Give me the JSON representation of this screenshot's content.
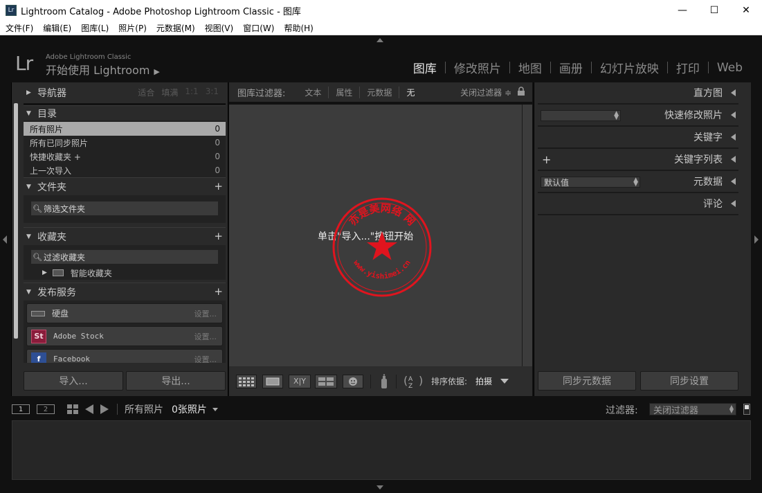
{
  "window": {
    "title": "Lightroom Catalog - Adobe Photoshop Lightroom Classic - 图库",
    "icon_text": "Lr",
    "minimize": "—",
    "maximize": "☐",
    "close": "✕"
  },
  "menubar": [
    "文件(F)",
    "编辑(E)",
    "图库(L)",
    "照片(P)",
    "元数据(M)",
    "视图(V)",
    "窗口(W)",
    "帮助(H)"
  ],
  "identity": {
    "logo": "Lr",
    "small": "Adobe Lightroom Classic",
    "main": "开始使用 Lightroom",
    "play": "▶"
  },
  "modules": [
    "图库",
    "修改照片",
    "地图",
    "画册",
    "幻灯片放映",
    "打印",
    "Web"
  ],
  "left": {
    "navigator": {
      "title": "导航器",
      "options": [
        "适合",
        "填满",
        "1:1",
        "3:1"
      ]
    },
    "catalog": {
      "title": "目录",
      "items": [
        {
          "label": "所有照片",
          "count": "0"
        },
        {
          "label": "所有已同步照片",
          "count": "0"
        },
        {
          "label": "快捷收藏夹 +",
          "count": "0"
        },
        {
          "label": "上一次导入",
          "count": "0"
        }
      ]
    },
    "folders": {
      "title": "文件夹",
      "filter_placeholder": "筛选文件夹",
      "plus": "+"
    },
    "collections": {
      "title": "收藏夹",
      "filter_placeholder": "过滤收藏夹",
      "plus": "+",
      "smart": "智能收藏夹"
    },
    "publish": {
      "title": "发布服务",
      "plus": "+",
      "services": [
        {
          "name": "硬盘",
          "setup": "设置..."
        },
        {
          "name": "Adobe Stock",
          "setup": "设置...",
          "icon": "St"
        },
        {
          "name": "Facebook",
          "setup": "设置...",
          "icon": "f"
        }
      ]
    },
    "import_label": "导入...",
    "export_label": "导出..."
  },
  "filterbar": {
    "title": "图库过滤器:",
    "items": [
      "文本",
      "属性",
      "元数据",
      "无"
    ],
    "preset": "关闭过滤器 ≑"
  },
  "grid": {
    "empty_message": "单击\"导入...\"按钮开始"
  },
  "toolbar": {
    "sort_label": "排序依据:",
    "sort_value": "拍摄"
  },
  "right": {
    "panels": [
      {
        "title": "直方图"
      },
      {
        "title": "快速修改照片",
        "dropdown": ""
      },
      {
        "title": "关键字"
      },
      {
        "title": "关键字列表",
        "plus": "+"
      },
      {
        "title": "元数据",
        "dropdown": "默认值"
      },
      {
        "title": "评论"
      }
    ],
    "sync_metadata": "同步元数据",
    "sync_settings": "同步设置"
  },
  "filmstrip": {
    "mon1": "1",
    "mon2": "2",
    "source": "所有照片",
    "photos": "0张照片",
    "filter_label": "过滤器:",
    "filter_value": "关闭过滤器"
  },
  "watermark": {
    "outer_text": "亦是美网络 网",
    "url": "www.yishimei.cn",
    "color": "#e0141e"
  },
  "colors": {
    "accent": "#e8e8e8",
    "panel": "#2a2a2a",
    "grid": "#3c3c3c"
  }
}
